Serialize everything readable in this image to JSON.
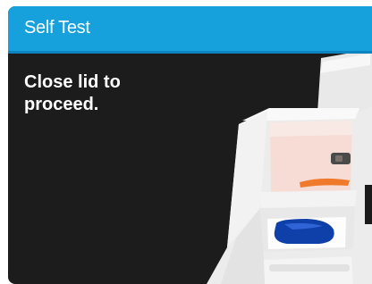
{
  "dialog": {
    "title": "Self Test",
    "message": "Close lid to\nproceed."
  },
  "colors": {
    "title_bar": "#16a0dc",
    "background": "#1c1c1c",
    "text": "#ffffff",
    "orange_slot": "#f07a2c",
    "blue_slot": "#0f3fa8"
  }
}
